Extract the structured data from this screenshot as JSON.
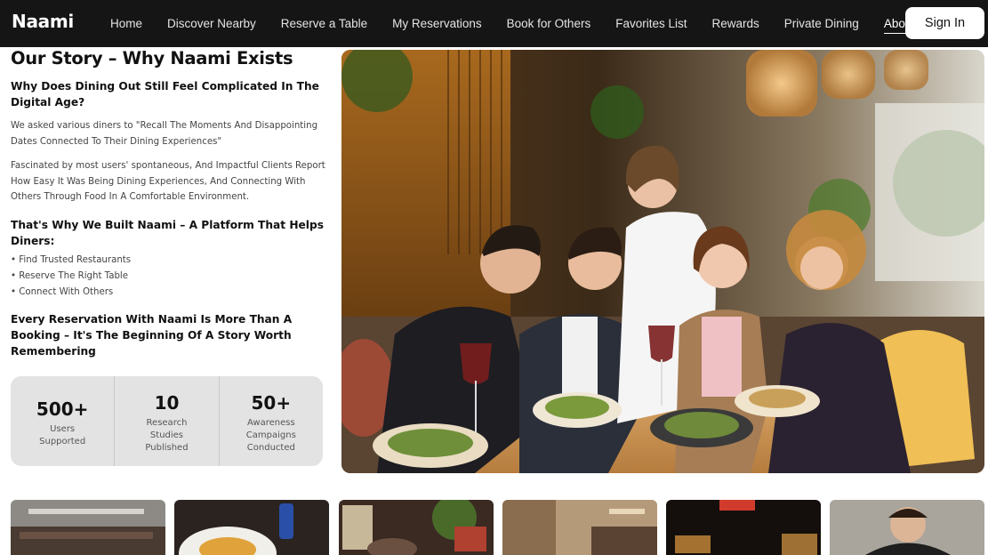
{
  "brand": "Naami",
  "nav": {
    "links": [
      "Home",
      "Discover Nearby",
      "Reserve a Table",
      "My Reservations",
      "Book for Others",
      "Favorites List",
      "Rewards",
      "Private Dining",
      "About"
    ],
    "active": "About",
    "signin_label": "Sign In"
  },
  "story": {
    "title": "Our Story – Why Naami Exists",
    "question": "Why Does Dining Out Still Feel Complicated In The Digital Age?",
    "paragraph1": "We asked various diners to \"Recall The Moments And Disappointing Dates Connected To Their Dining Experiences\"",
    "paragraph2": "Fascinated by most users' spontaneous, And Impactful Clients Report How Easy It Was Being Dining Experiences, And Connecting With Others Through Food In A Comfortable Environment.",
    "platform_heading": "That's Why We Built Naami – A Platform That Helps Diners:",
    "bullets": [
      "Find Trusted Restaurants",
      "Reserve The Right Table",
      "Connect With Others"
    ],
    "closing": "Every Reservation With Naami Is More Than A Booking – It's The Beginning Of A Story Worth Remembering"
  },
  "stats": [
    {
      "value": "500+",
      "label": "Users Supported"
    },
    {
      "value": "10",
      "label": "Research Studies Published"
    },
    {
      "value": "50+",
      "label": "Awareness Campaigns Conducted"
    }
  ],
  "colors": {
    "nav_bg": "#151515",
    "stats_bg": "#e3e3e3",
    "accent_text": "#111111"
  }
}
